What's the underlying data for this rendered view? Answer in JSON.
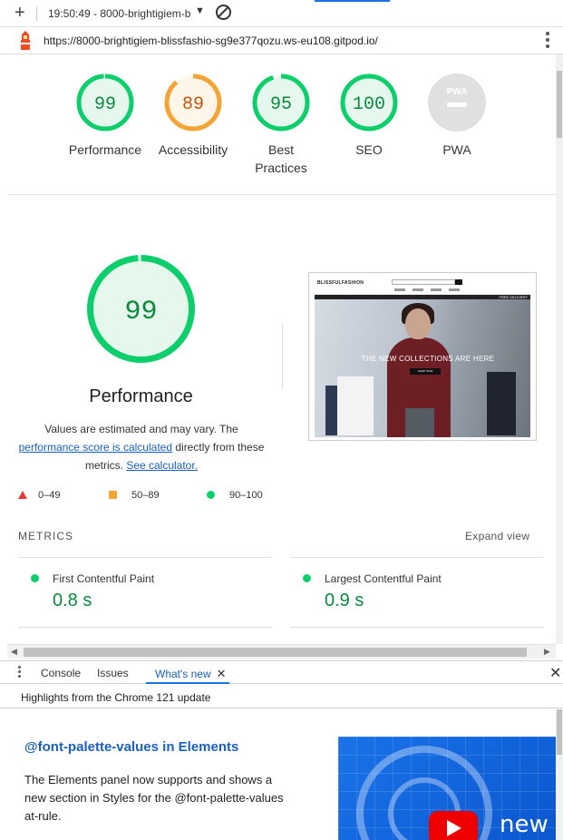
{
  "topbar": {
    "report_label": "19:50:49 - 8000-brightigiem-b",
    "url": "https://8000-brightigiem-blissfashio-sg9e377qozu.ws-eu108.gitpod.io/"
  },
  "gauges": [
    {
      "score": "99",
      "label": "Performance",
      "fraction": 0.99,
      "color": "#0cce6b",
      "text_color": "#0a8a3c",
      "bg": "#e6f7ee"
    },
    {
      "score": "89",
      "label": "Accessibility",
      "fraction": 0.89,
      "color": "#f4a335",
      "text_color": "#c4520b",
      "bg": "#fef6e9"
    },
    {
      "score": "95",
      "label": "Best Practices",
      "fraction": 0.95,
      "color": "#0cce6b",
      "text_color": "#0a8a3c",
      "bg": "#e6f7ee"
    },
    {
      "score": "100",
      "label": "SEO",
      "fraction": 1.0,
      "color": "#0cce6b",
      "text_color": "#0a8a3c",
      "bg": "#e6f7ee"
    },
    {
      "score": "PWA",
      "label": "PWA",
      "fraction": 0,
      "color": "#d0d0d0",
      "text_color": "#ffffff",
      "bg": "#e0e0e0"
    }
  ],
  "performance": {
    "score": "99",
    "title": "Performance",
    "desc_1": "Values are estimated and may vary. The",
    "desc_link": "performance score is calculated",
    "desc_2": " directly from these metrics. ",
    "desc_link_2": "See calculator."
  },
  "screenshot": {
    "logo": "BLISSFULFASHION",
    "ship": "FREE DELIVERY",
    "headline": "THE NEW COLLECTIONS ARE HERE",
    "button": "SHOP NOW"
  },
  "legend": [
    {
      "range": "0–49"
    },
    {
      "range": "50–89"
    },
    {
      "range": "90–100"
    }
  ],
  "metrics": {
    "header": "METRICS",
    "expand": "Expand view",
    "items": [
      {
        "name": "First Contentful Paint",
        "value": "0.8 s"
      },
      {
        "name": "Largest Contentful Paint",
        "value": "0.9 s"
      }
    ]
  },
  "drawer": {
    "tabs": [
      "Console",
      "Issues",
      "What's new"
    ],
    "highlights": "Highlights from the Chrome 121 update",
    "wn_title": "@font-palette-values in Elements",
    "wn_text": "The Elements panel now supports and shows a new section in Styles for the @font-palette-values at-rule.",
    "wn_img_text": "new"
  }
}
